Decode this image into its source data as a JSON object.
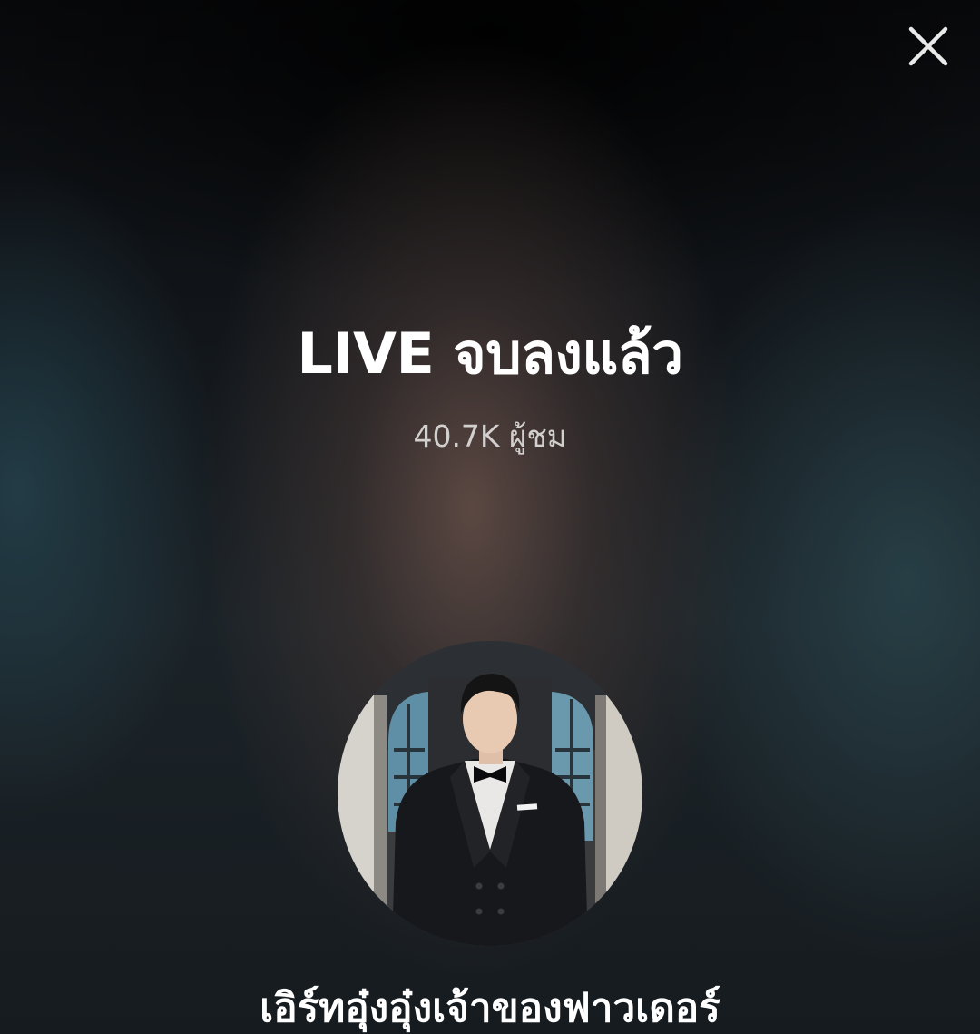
{
  "live_ended": {
    "title": "LIVE จบลงแล้ว",
    "viewer_count": "40.7K ผู้ชม",
    "host": {
      "name": "เอิร์ทอุ๋งอุ๋งเจ้าของฟาวเดอร์"
    }
  },
  "icons": {
    "close": "close-icon",
    "avatar": "avatar"
  },
  "colors": {
    "text_primary": "#ffffff",
    "text_secondary": "#d2d0cf"
  }
}
